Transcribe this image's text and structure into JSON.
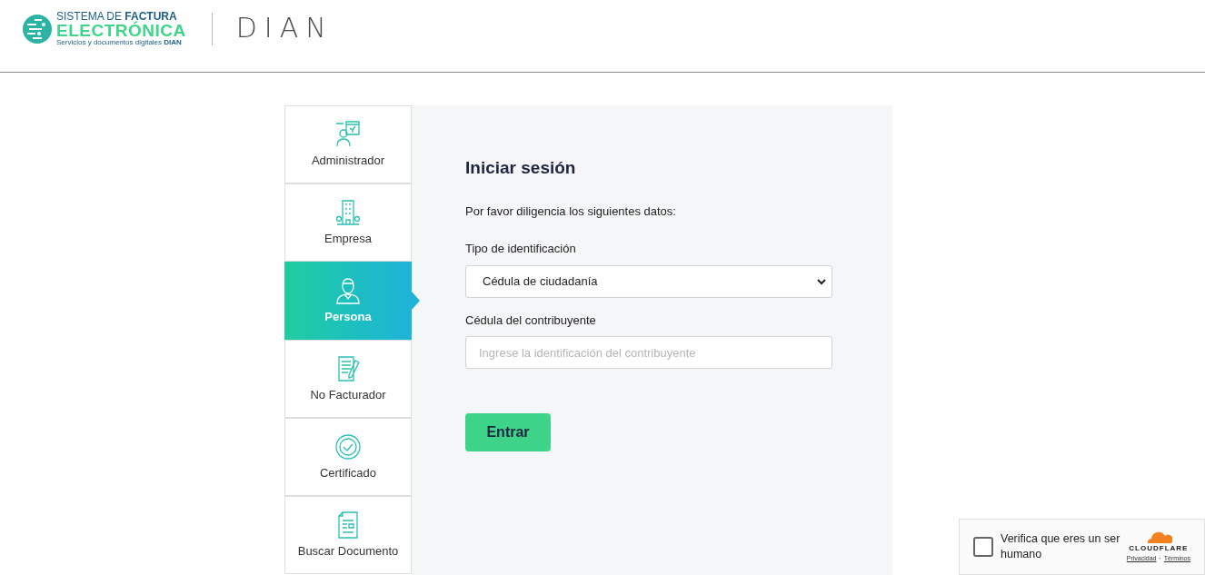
{
  "header": {
    "logo": {
      "line_1": "SISTEMA DE **FACTURA**",
      "line_2": "ELECTRÓNICA",
      "line_3": "Servicios y documentos digitales **DIAN**"
    },
    "brand": "DIAN"
  },
  "tabs": [
    {
      "label": "Administrador",
      "kind": "admin",
      "selected": false
    },
    {
      "label": "Empresa",
      "kind": "building",
      "selected": false
    },
    {
      "label": "Persona",
      "kind": "person",
      "selected": true
    },
    {
      "label": "No Facturador",
      "kind": "document-pen",
      "selected": false
    },
    {
      "label": "Certificado",
      "kind": "badge",
      "selected": false
    },
    {
      "label": "Buscar Documento",
      "kind": "document",
      "selected": false
    }
  ],
  "form": {
    "title": "Iniciar sesión",
    "intro": "Por favor diligencia los siguientes datos:",
    "id_type": {
      "label": "Tipo de identificación",
      "value": "Cédula de ciudadanía"
    },
    "id_number": {
      "label": "Cédula del contribuyente",
      "placeholder": "Ingrese la identificación del contribuyente"
    },
    "submit": "Entrar"
  },
  "captcha": {
    "checked": false,
    "label": "Verifica que eres un ser humano",
    "brand": "CLOUDFLARE",
    "links": [
      "Privacidad",
      "Términos"
    ],
    "separator": "·"
  }
}
